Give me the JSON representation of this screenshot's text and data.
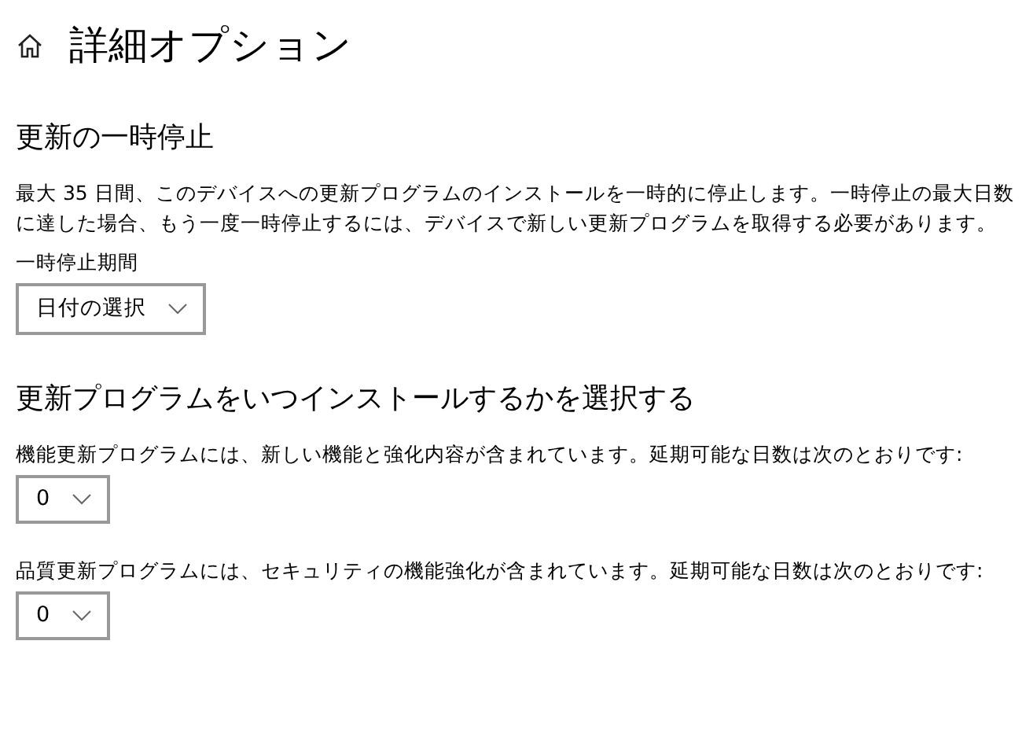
{
  "page": {
    "title": "詳細オプション"
  },
  "sections": [
    {
      "heading": "更新の一時停止",
      "description": "最大 35 日間、このデバイスへの更新プログラムのインストールを一時的に停止します。一時停止の最大日数に達した場合、もう一度一時停止するには、デバイスで新しい更新プログラムを取得する必要があります。",
      "fields": [
        {
          "label": "一時停止期間",
          "value": "日付の選択"
        }
      ]
    },
    {
      "heading": "更新プログラムをいつインストールするかを選択する",
      "fields": [
        {
          "label": "機能更新プログラムには、新しい機能と強化内容が含まれています。延期可能な日数は次のとおりです:",
          "value": "0"
        },
        {
          "label": "品質更新プログラムには、セキュリティの機能強化が含まれています。延期可能な日数は次のとおりです:",
          "value": "0"
        }
      ]
    }
  ]
}
